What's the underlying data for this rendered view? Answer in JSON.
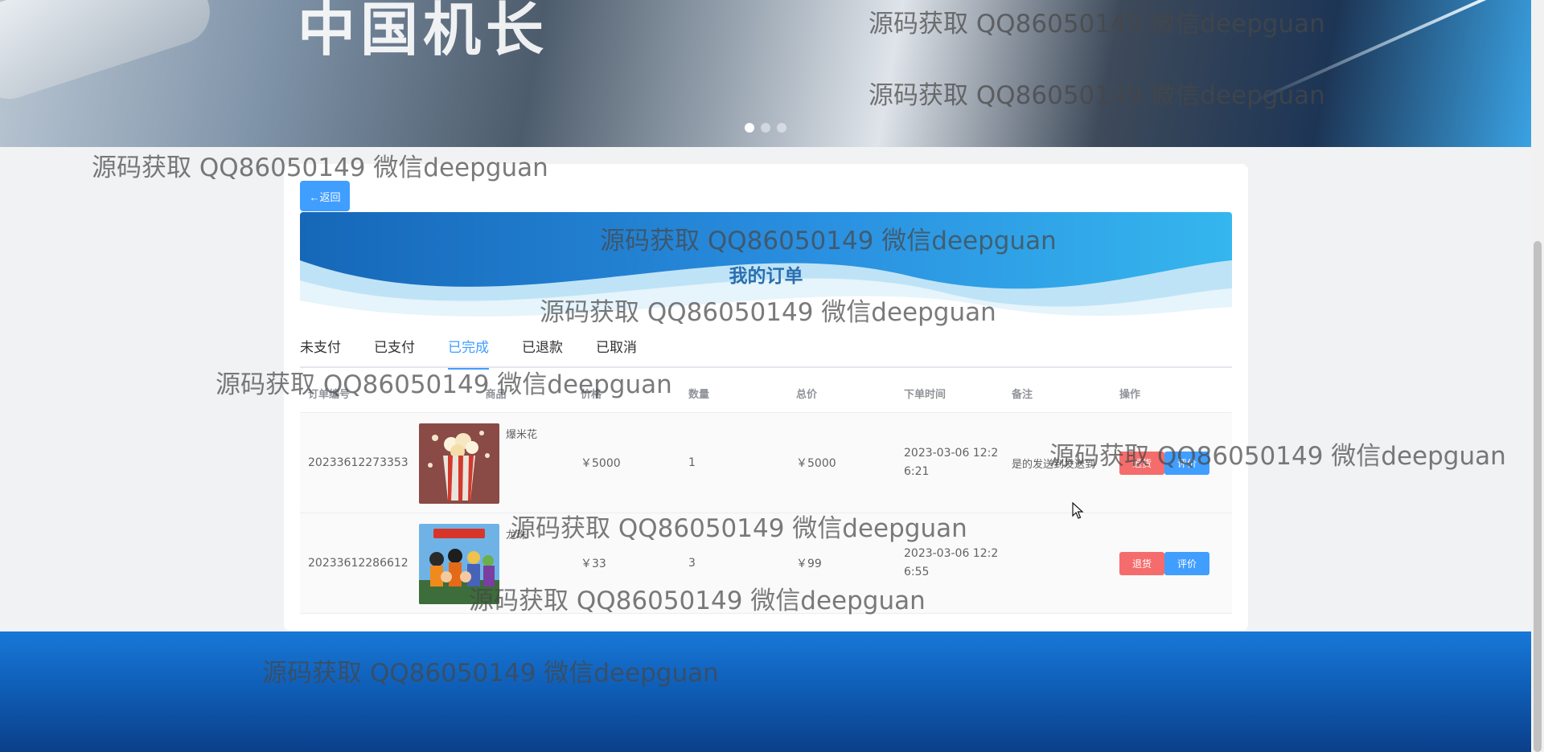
{
  "banner": {
    "movie_title": "中国机长",
    "dots": 3,
    "active_dot": 0
  },
  "back_label": "←返回",
  "header_title": "我的订单",
  "tabs": [
    {
      "label": "未支付",
      "active": false
    },
    {
      "label": "已支付",
      "active": false
    },
    {
      "label": "已完成",
      "active": true
    },
    {
      "label": "已退款",
      "active": false
    },
    {
      "label": "已取消",
      "active": false
    }
  ],
  "table": {
    "headers": [
      "订单编号",
      "商品",
      "价格",
      "数量",
      "总价",
      "下单时间",
      "备注",
      "操作"
    ],
    "rows": [
      {
        "order_id": "20233612273353",
        "goods_name": "爆米花",
        "goods_icon": "popcorn-image",
        "price": "￥5000",
        "qty": "1",
        "total": "￥5000",
        "time": "2023-03-06 12:26:21",
        "note": "是的发送到发送到",
        "refund_label": "退货",
        "review_label": "评价"
      },
      {
        "order_id": "20233612286612",
        "goods_name": "龙珠",
        "goods_icon": "dragon-ball-poster-image",
        "price": "￥33",
        "qty": "3",
        "total": "￥99",
        "time": "2023-03-06 12:26:55",
        "note": "",
        "refund_label": "退货",
        "review_label": "评价"
      }
    ]
  },
  "watermark_text": "源码获取 QQ86050149 微信deepguan",
  "colors": {
    "primary": "#409eff",
    "danger": "#f56c6c",
    "footer": "#1878d8"
  }
}
